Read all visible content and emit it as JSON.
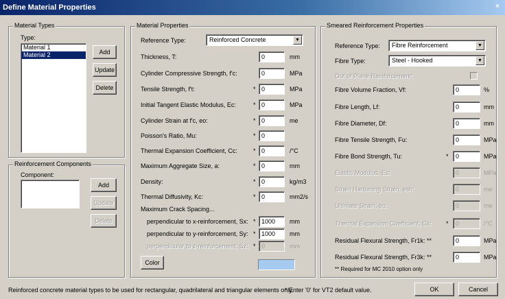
{
  "window": {
    "title": "Define Material Properties",
    "close_glyph": "×"
  },
  "material_types": {
    "legend": "Material Types",
    "type_label": "Type:",
    "items": [
      "Material 1",
      "Material 2"
    ],
    "selected_index": 1,
    "add_label": "Add",
    "update_label": "Update",
    "delete_label": "Delete"
  },
  "reinforcement_components": {
    "legend": "Reinforcement Components",
    "component_label": "Component:",
    "add_label": "Add",
    "update_label": "Update",
    "delete_label": "Delete"
  },
  "material_properties": {
    "legend": "Material Properties",
    "reference_type_label": "Reference Type:",
    "reference_type_value": "Reinforced Concrete",
    "rows": [
      {
        "label": "Thickness, T:",
        "star": "",
        "value": "0",
        "unit": "mm"
      },
      {
        "label": "Cylinder Compressive Strength, f'c:",
        "star": "",
        "value": "0",
        "unit": "MPa"
      },
      {
        "label": "Tensile Strength, f't:",
        "star": "*",
        "value": "0",
        "unit": "MPa"
      },
      {
        "label": "Initial Tangent Elastic Modulus, Ec:",
        "star": "*",
        "value": "0",
        "unit": "MPa"
      },
      {
        "label": "Cylinder Strain at f'c, eo:",
        "star": "*",
        "value": "0",
        "unit": "me"
      },
      {
        "label": "Poisson's Ratio, Mu:",
        "star": "*",
        "value": "0",
        "unit": ""
      },
      {
        "label": "Thermal Expansion Coefficient, Cc:",
        "star": "*",
        "value": "0",
        "unit": "/°C"
      },
      {
        "label": "Maximum Aggregate Size, a:",
        "star": "*",
        "value": "0",
        "unit": "mm"
      },
      {
        "label": "Density:",
        "star": "*",
        "value": "0",
        "unit": "kg/m3"
      },
      {
        "label": "Thermal Diffusivity, Kc:",
        "star": "*",
        "value": "0",
        "unit": "mm2/s"
      }
    ],
    "max_crack_label": "Maximum Crack Spacing...",
    "crack_rows": [
      {
        "label": "perpendicular to x-reinforcement, Sx:",
        "star": "*",
        "value": "1000",
        "unit": "mm"
      },
      {
        "label": "perpendicular to y-reinforcement, Sy:",
        "star": "*",
        "value": "1000",
        "unit": "mm"
      },
      {
        "label": "perpendicular to z-reinforcement, Sz:",
        "star": "*",
        "value": "0",
        "unit": "mm"
      }
    ],
    "color_label": "Color",
    "color_value": "#a6caf0"
  },
  "smeared": {
    "legend": "Smeared Reinforcement Properties",
    "reference_type_label": "Reference Type:",
    "reference_type_value": "Fibre Reinforcement",
    "fibre_type_label": "Fibre Type:",
    "fibre_type_value": "Steel - Hooked",
    "out_of_plane_label": "Out of Plane Reinforcement:",
    "rows": [
      {
        "label": "Fibre Volume Fraction, Vf:",
        "star": "",
        "value": "0",
        "unit": "%"
      },
      {
        "label": "Fibre Length, Lf:",
        "star": "",
        "value": "0",
        "unit": "mm"
      },
      {
        "label": "Fibre Diameter, Df:",
        "star": "",
        "value": "0",
        "unit": "mm"
      },
      {
        "label": "Fibre Tensile Strength, Fu:",
        "star": "",
        "value": "0",
        "unit": "MPa"
      },
      {
        "label": "Fibre Bond Strength, Tu:",
        "star": "*",
        "value": "0",
        "unit": "MPa"
      },
      {
        "label": "Elastic Modulus, Es:",
        "star": "",
        "value": "0",
        "unit": "MPa"
      },
      {
        "label": "Strain Hardening Strain, esh:",
        "star": "",
        "value": "0",
        "unit": "me"
      },
      {
        "label": "Ultimate Strain, eu:",
        "star": "",
        "value": "0",
        "unit": "me"
      },
      {
        "label": "Thermal Expansion Coefficient, Cs:",
        "star": "*",
        "value": "0",
        "unit": "/°C"
      },
      {
        "label": "Residual Flexural Strength, Fr1k: **",
        "star": "",
        "value": "0",
        "unit": "MPa"
      },
      {
        "label": "Residual Flexural Strength, Fr3k: **",
        "star": "",
        "value": "0",
        "unit": "MPa"
      }
    ],
    "mc2010_note": "** Required for MC 2010 option only"
  },
  "footer": {
    "note": "Reinforced concrete material types to be used for rectangular, quadrilateral and triangular elements only.",
    "vt2_note": "* Enter '0' for VT2 default value.",
    "ok_label": "OK",
    "cancel_label": "Cancel"
  }
}
